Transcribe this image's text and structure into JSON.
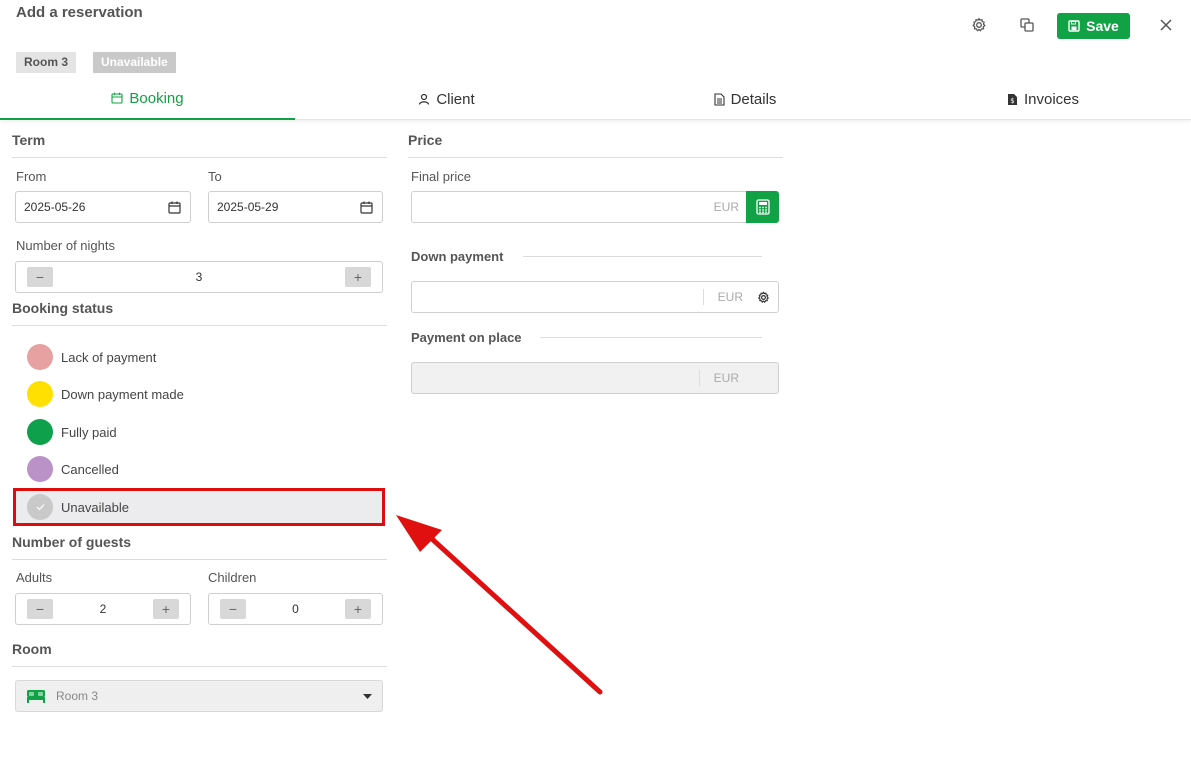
{
  "header": {
    "title": "Add a reservation",
    "room_badge": "Room 3",
    "status_badge": "Unavailable",
    "save_label": "Save"
  },
  "tabs": [
    {
      "label": "Booking",
      "icon": "calendar-icon",
      "active": true
    },
    {
      "label": "Client",
      "icon": "user-icon"
    },
    {
      "label": "Details",
      "icon": "document-icon"
    },
    {
      "label": "Invoices",
      "icon": "invoice-icon"
    }
  ],
  "term": {
    "section_title": "Term",
    "from_label": "From",
    "from_value": "2025-05-26",
    "to_label": "To",
    "to_value": "2025-05-29",
    "nights_label": "Number of nights",
    "nights_value": "3"
  },
  "booking_status": {
    "section_title": "Booking status",
    "items": [
      {
        "label": "Lack of payment",
        "color": "#e8a1a1"
      },
      {
        "label": "Down payment made",
        "color": "#ffe000"
      },
      {
        "label": "Fully paid",
        "color": "#0ea04a"
      },
      {
        "label": "Cancelled",
        "color": "#bb92c8"
      },
      {
        "label": "Unavailable",
        "color": "#c9c9c9",
        "selected": true
      }
    ]
  },
  "guests": {
    "section_title": "Number of guests",
    "adults_label": "Adults",
    "adults_value": "2",
    "children_label": "Children",
    "children_value": "0",
    "minus": "−",
    "plus": "+"
  },
  "room": {
    "section_title": "Room",
    "selected": "Room 3",
    "icon": "bed-icon"
  },
  "price": {
    "section_title": "Price",
    "final_label": "Final price",
    "final_value": "",
    "currency": "EUR",
    "down_payment_label": "Down payment",
    "down_payment_value": "",
    "on_place_label": "Payment on place",
    "on_place_value": ""
  },
  "colors": {
    "accent": "#10a245",
    "highlight": "#dd0d0d"
  }
}
